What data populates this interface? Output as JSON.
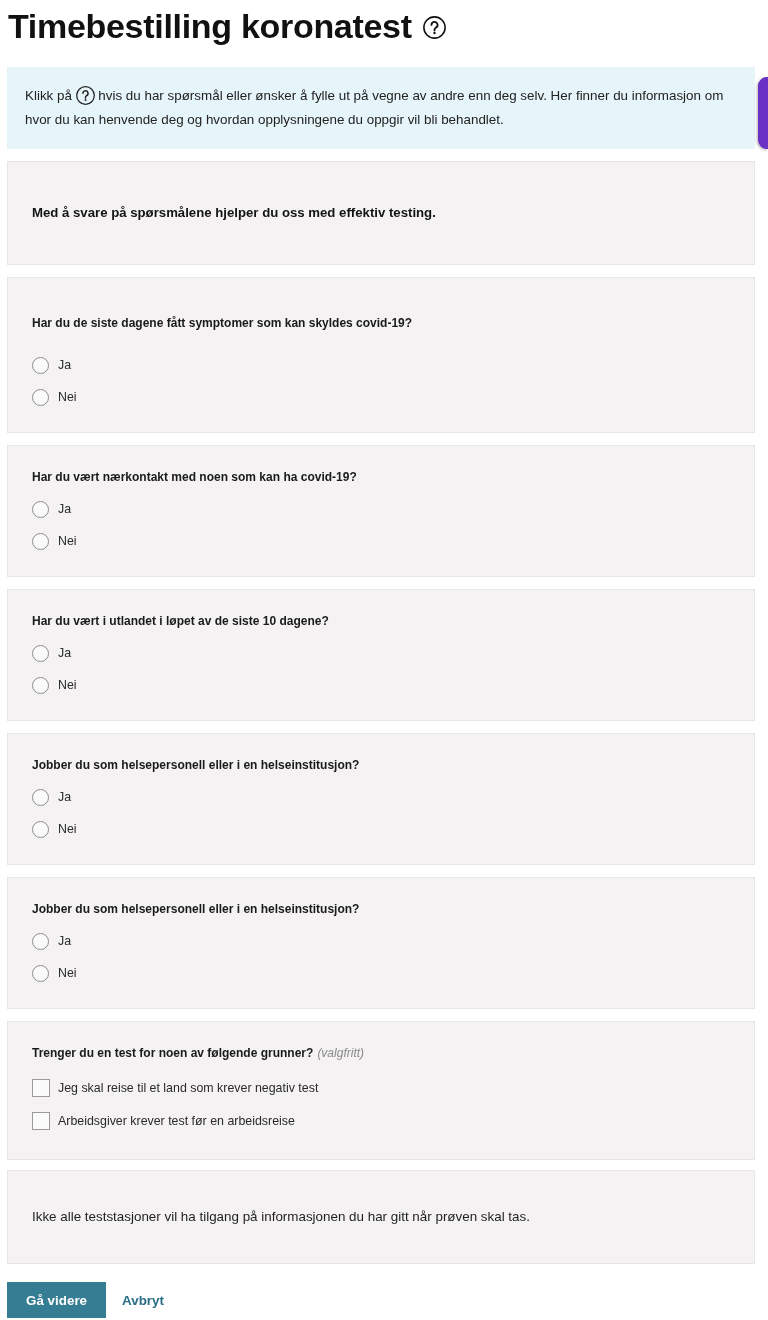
{
  "page": {
    "title": "Timebestilling koronatest"
  },
  "info": {
    "text_before_icon": "Klikk på",
    "text_after_icon": "hvis du har spørsmål eller ønsker å fylle ut på vegne av andre enn deg selv. Her finner du informasjon om hvor du kan henvende deg og hvordan opplysningene du oppgir vil bli behandlet."
  },
  "intro": {
    "text": "Med å svare på spørsmålene hjelper du oss med effektiv testing."
  },
  "questions": [
    {
      "kind": "radio",
      "label": "Har du de siste dagene fått symptomer som kan skyldes covid-19?",
      "options": [
        {
          "label": "Ja",
          "selected": false
        },
        {
          "label": "Nei",
          "selected": false
        }
      ]
    },
    {
      "kind": "radio",
      "label": "Har du vært nærkontakt med noen som kan ha covid-19?",
      "options": [
        {
          "label": "Ja",
          "selected": false
        },
        {
          "label": "Nei",
          "selected": false
        }
      ]
    },
    {
      "kind": "radio",
      "label": "Har du vært i utlandet i løpet av de siste 10 dagene?",
      "options": [
        {
          "label": "Ja",
          "selected": false
        },
        {
          "label": "Nei",
          "selected": false
        }
      ]
    },
    {
      "kind": "radio",
      "label": "Jobber du som helsepersonell eller i en helseinstitusjon?",
      "options": [
        {
          "label": "Ja",
          "selected": false
        },
        {
          "label": "Nei",
          "selected": false
        }
      ]
    },
    {
      "kind": "radio",
      "label": "Jobber du som helsepersonell eller i en helseinstitusjon?",
      "options": [
        {
          "label": "Ja",
          "selected": false
        },
        {
          "label": "Nei",
          "selected": false
        }
      ]
    },
    {
      "kind": "checkbox",
      "label": "Trenger du en test for noen av følgende grunner?",
      "optional_note": "(valgfritt)",
      "options": [
        {
          "label": "Jeg skal reise til et land som krever negativ test",
          "checked": false
        },
        {
          "label": "Arbeidsgiver krever test før en arbeidsreise",
          "checked": false
        }
      ]
    }
  ],
  "notice": {
    "text": "Ikke alle teststasjoner vil ha tilgang på informasjonen du har gitt når prøven skal tas."
  },
  "actions": [
    {
      "kind": "button",
      "label": "Gå videre"
    },
    {
      "kind": "link",
      "label": "Avbryt"
    }
  ]
}
